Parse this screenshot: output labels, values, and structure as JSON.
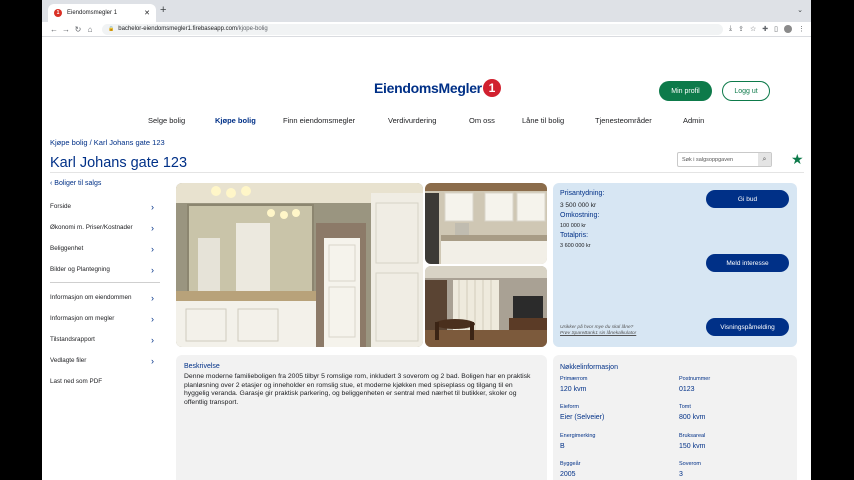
{
  "browser": {
    "tab_title": "Eiendomsmegler 1",
    "tab_favicon": "1",
    "url_host": "bachelor-eiendomsmegler1.firebaseapp.com",
    "url_path": "/kjope-bolig"
  },
  "header": {
    "logo_text": "EiendomsMegler",
    "logo_mark": "1",
    "profile_label": "Min profil",
    "logout_label": "Logg ut"
  },
  "nav": [
    "Selge bolig",
    "Kjøpe bolig",
    "Finn eiendomsmegler",
    "Verdivurdering",
    "Om oss",
    "Låne til bolig",
    "Tjenesteområder",
    "Admin"
  ],
  "breadcrumb": "Kjøpe bolig / Karl Johans gate 123",
  "title": "Karl Johans gate 123",
  "search": {
    "placeholder": "Søk i salgsoppgaven"
  },
  "sidebar": {
    "back": "Boliger til salgs",
    "group1": [
      "Forside",
      "Økonomi m. Priser/Kostnader",
      "Beliggenhet",
      "Bilder og Plantegning"
    ],
    "group2": [
      "Informasjon om eiendommen",
      "Informasjon om megler",
      "Tilstandsrapport",
      "Vedlagte filer",
      "Last ned som PDF"
    ]
  },
  "price": {
    "prisantydning_label": "Prisantydning:",
    "prisantydning": "3 500 000 kr",
    "omkostning_label": "Omkostning:",
    "omkostning": "100 000 kr",
    "totalpris_label": "Totalpris:",
    "totalpris": "3 600 000 kr",
    "bid_label": "Gi bud",
    "interest_label": "Meld interesse",
    "viewing_label": "Visningspåmelding",
    "note_line1": "Usikker på hvor mye du skal låne?",
    "note_line2": "Prøv SpareBank1 sin lånekalkulator"
  },
  "description": {
    "title": "Beskrivelse",
    "body": "Denne moderne familieboligen fra 2005 tilbyr 5 romslige rom, inkludert 3 soverom og 2 bad. Boligen har en praktisk planløsning over 2 etasjer og inneholder en romslig stue, et moderne kjøkken med spiseplass og tilgang til en hyggelig veranda. Garasje gir praktisk parkering, og beliggenheten er sentral med nærhet til butikker, skoler og offentlig transport."
  },
  "facts": {
    "title": "Nøkkelinformasjon",
    "items": [
      {
        "key": "Primærrom",
        "value": "120 kvm"
      },
      {
        "key": "Postnummer",
        "value": "0123"
      },
      {
        "key": "Eieform",
        "value": "Eier (Selveier)"
      },
      {
        "key": "Tomt",
        "value": "800 kvm"
      },
      {
        "key": "Energimerking",
        "value": "B"
      },
      {
        "key": "Bruksareal",
        "value": "150 kvm"
      },
      {
        "key": "Byggeår",
        "value": "2005"
      },
      {
        "key": "Soverom",
        "value": "3"
      }
    ]
  },
  "colors": {
    "brand_blue": "#003087",
    "brand_green": "#0d7a4a",
    "brand_red": "#d1202f",
    "price_card": "#d7e6f3"
  }
}
